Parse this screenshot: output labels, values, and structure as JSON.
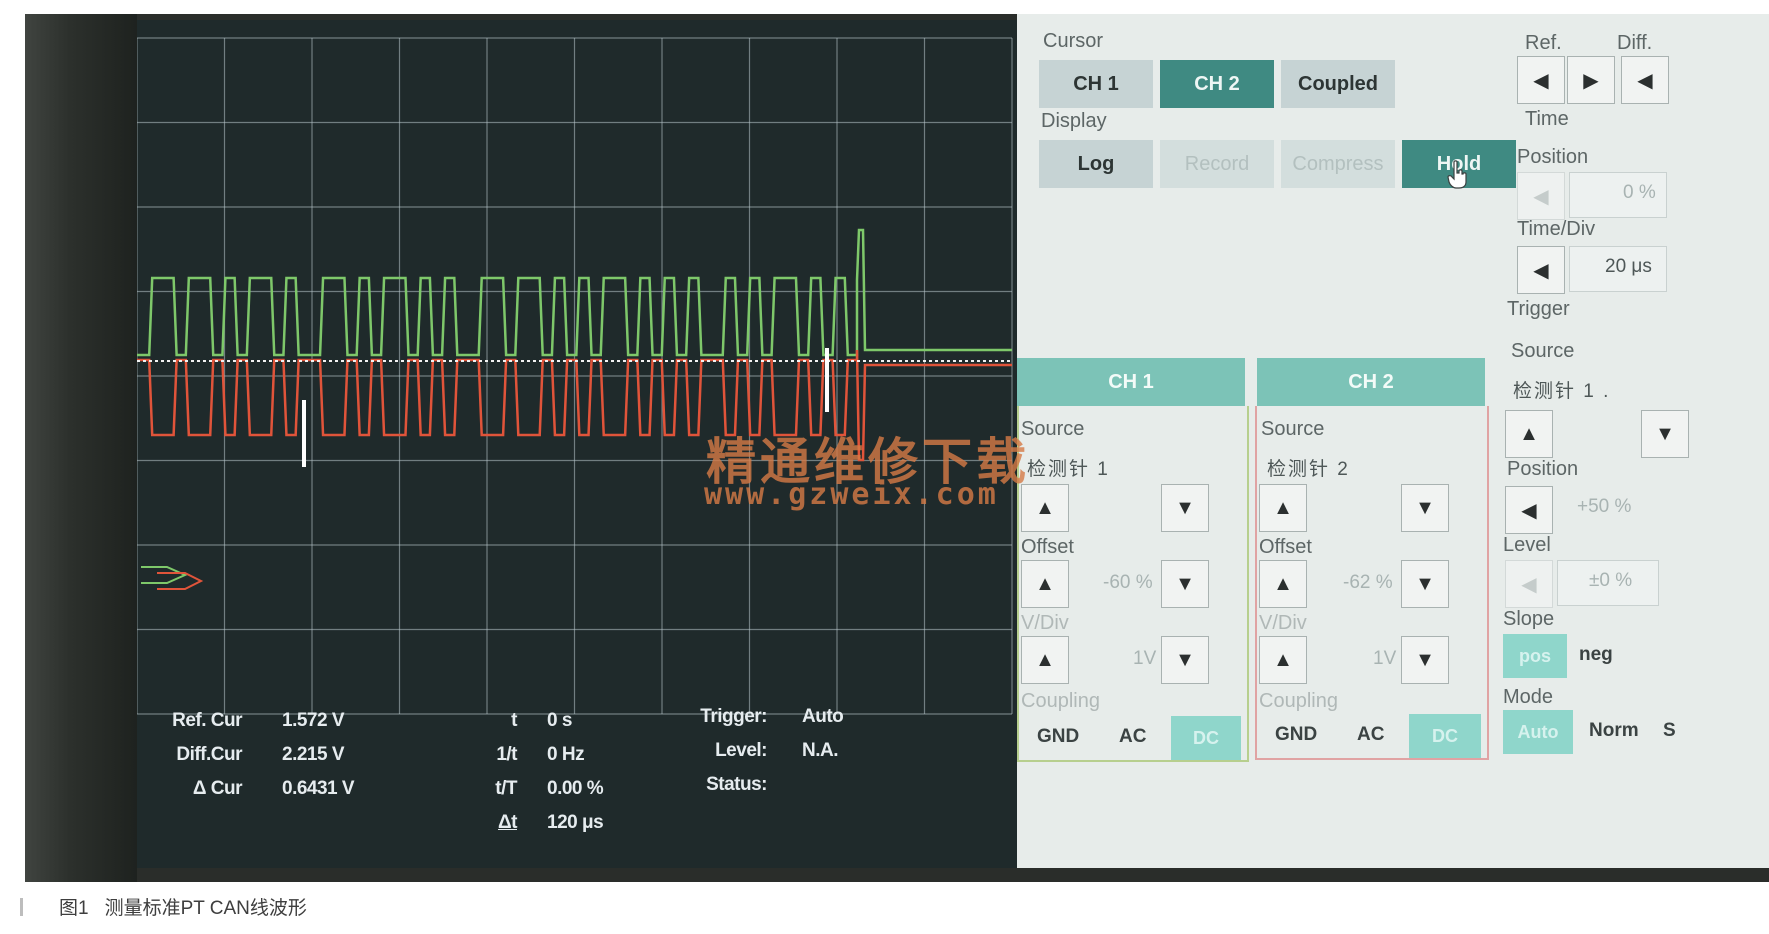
{
  "colors": {
    "ch1_trace": "#7ec86a",
    "ch2_trace": "#e0543a",
    "screen_bg": "#1f2a2b",
    "grid": "#b5c3c8",
    "accent": "#3f8a82",
    "channel_header": "#7cc3b7"
  },
  "readouts": {
    "ref_cur_label": "Ref. Cur",
    "ref_cur_value": "1.572 V",
    "diff_cur_label": "Diff.Cur",
    "diff_cur_value": "2.215 V",
    "delta_cur_label": "Δ Cur",
    "delta_cur_value": "0.6431 V",
    "t_label": "t",
    "t_value": "0 s",
    "inv_t_label": "1/t",
    "inv_t_value": "0 Hz",
    "t_over_T_label": "t/T",
    "t_over_T_value": "0.00 %",
    "delta_t_label": "Δt",
    "delta_t_value": "120 μs",
    "trigger_label": "Trigger:",
    "trigger_value": "Auto",
    "level_label": "Level:",
    "level_value": "N.A.",
    "status_label": "Status:"
  },
  "cursor": {
    "title": "Cursor",
    "buttons": [
      "CH 1",
      "CH 2",
      "Coupled"
    ],
    "active": "CH 2"
  },
  "display": {
    "title": "Display",
    "buttons": [
      "Log",
      "Record",
      "Compress",
      "Hold"
    ],
    "active": "Hold"
  },
  "ref_diff": {
    "ref_label": "Ref.",
    "diff_label": "Diff."
  },
  "time": {
    "title": "Time",
    "position_label": "Position",
    "position_value": "0 %",
    "timediv_label": "Time/Div",
    "timediv_value": "20 μs"
  },
  "trigger": {
    "title": "Trigger",
    "source_label": "Source",
    "source_value": "检测针 1 .",
    "position_label": "Position",
    "position_value": "+50 %",
    "level_label": "Level",
    "level_value": "±0 %",
    "slope_label": "Slope",
    "slope_pos": "pos",
    "slope_neg": "neg",
    "mode_label": "Mode",
    "mode_auto": "Auto",
    "mode_norm": "Norm",
    "mode_third": "S"
  },
  "ch1": {
    "header": "CH 1",
    "source_label": "Source",
    "source_value": "检测针 1",
    "offset_label": "Offset",
    "offset_value": "-60 %",
    "vdiv_label": "V/Div",
    "vdiv_value": "1V",
    "coupling_label": "Coupling",
    "coupling_gnd": "GND",
    "coupling_ac": "AC",
    "coupling_dc": "DC"
  },
  "ch2": {
    "header": "CH 2",
    "source_label": "Source",
    "source_value": "检测针 2",
    "offset_label": "Offset",
    "offset_value": "-62 %",
    "vdiv_label": "V/Div",
    "vdiv_value": "1V",
    "coupling_label": "Coupling",
    "coupling_gnd": "GND",
    "coupling_ac": "AC",
    "coupling_dc": "DC"
  },
  "watermark": {
    "line1": "精通维修下载",
    "line2": "www.gzweix.com"
  },
  "caption": {
    "figure": "图1",
    "text": "测量标准PT CAN线波形"
  },
  "icons": {
    "up": "up-triangle-icon",
    "down": "down-triangle-icon",
    "left": "left-triangle-icon",
    "right": "right-triangle-icon",
    "pointer": "hand-pointer-icon"
  }
}
